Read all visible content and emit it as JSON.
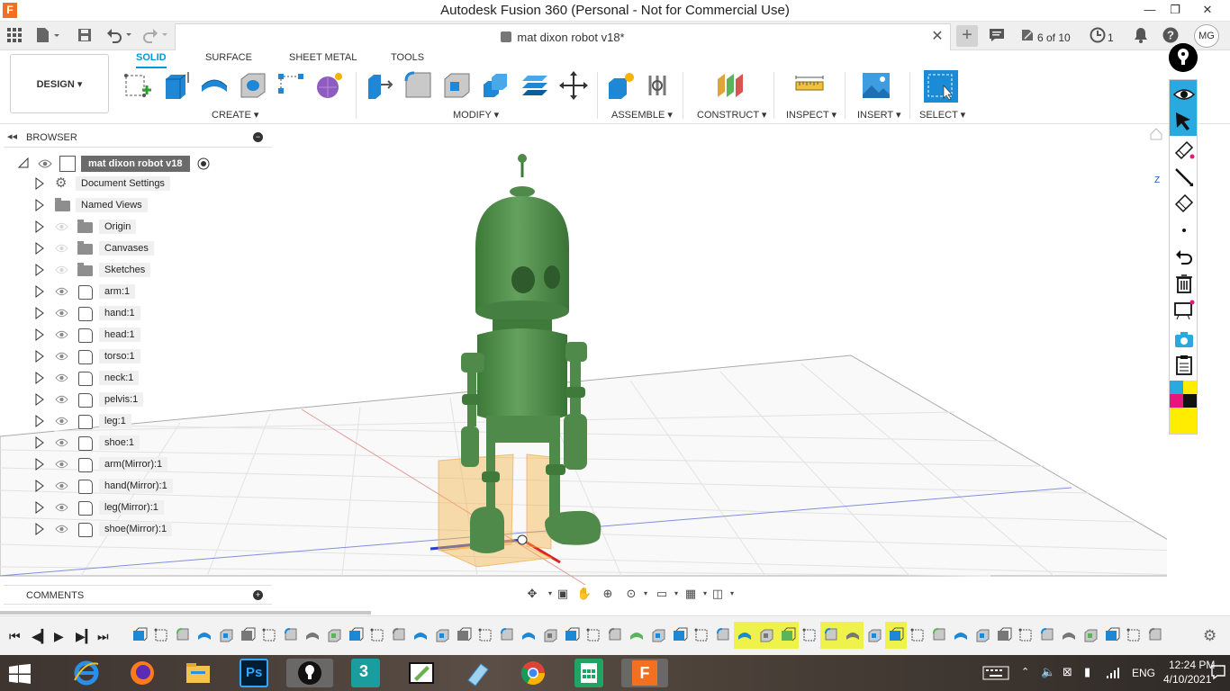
{
  "window": {
    "title": "Autodesk Fusion 360 (Personal - Not for Commercial Use)",
    "app_icon_letter": "F",
    "minimize": "—",
    "maximize": "❐",
    "close": "✕"
  },
  "doc_tab": {
    "title": "mat dixon robot v18*",
    "close": "✕",
    "jobs": "6 of 10",
    "notifications": "1",
    "user_initials": "MG"
  },
  "ribbon": {
    "workspace": "DESIGN ▾",
    "tabs": [
      "SOLID",
      "SURFACE",
      "SHEET METAL",
      "TOOLS"
    ],
    "groups": {
      "create": "CREATE ▾",
      "modify": "MODIFY ▾",
      "assemble": "ASSEMBLE ▾",
      "construct": "CONSTRUCT ▾",
      "inspect": "INSPECT ▾",
      "insert": "INSERT ▾",
      "select": "SELECT ▾"
    }
  },
  "browser": {
    "title": "BROWSER",
    "root": "mat dixon robot v18",
    "items": [
      {
        "label": "Document Settings",
        "kind": "settings"
      },
      {
        "label": "Named Views",
        "kind": "folder"
      },
      {
        "label": "Origin",
        "kind": "folder"
      },
      {
        "label": "Canvases",
        "kind": "folder"
      },
      {
        "label": "Sketches",
        "kind": "folder"
      },
      {
        "label": "arm:1",
        "kind": "component"
      },
      {
        "label": "hand:1",
        "kind": "component"
      },
      {
        "label": "head:1",
        "kind": "component"
      },
      {
        "label": "torso:1",
        "kind": "component"
      },
      {
        "label": "neck:1",
        "kind": "component"
      },
      {
        "label": "pelvis:1",
        "kind": "component"
      },
      {
        "label": "leg:1",
        "kind": "component"
      },
      {
        "label": "shoe:1",
        "kind": "component"
      },
      {
        "label": "arm(Mirror):1",
        "kind": "component"
      },
      {
        "label": "hand(Mirror):1",
        "kind": "component"
      },
      {
        "label": "leg(Mirror):1",
        "kind": "component"
      },
      {
        "label": "shoe(Mirror):1",
        "kind": "component"
      }
    ]
  },
  "comments": {
    "title": "COMMENTS"
  },
  "viewcube": {
    "axis_z": "Z"
  },
  "taskbar": {
    "language": "ENG",
    "time": "12:24 PM",
    "date": "4/10/2021"
  },
  "colors": {
    "accent": "#0696d7",
    "robot_green": "#4f8a4a",
    "selection_orange": "#f5b44a",
    "select_tool": "#1a8bd6"
  }
}
